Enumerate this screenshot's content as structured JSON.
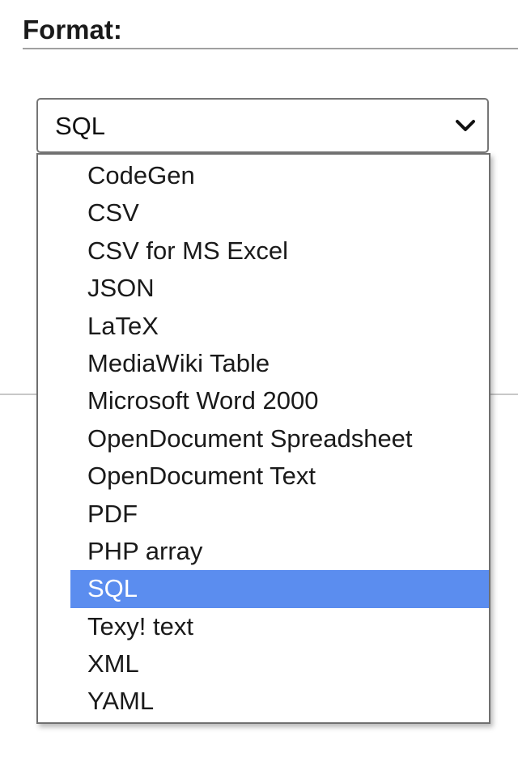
{
  "format_section": {
    "heading": "Format:"
  },
  "format_select": {
    "selected_value": "SQL",
    "chevron_icon": "chevron-down-icon",
    "options": [
      "CodeGen",
      "CSV",
      "CSV for MS Excel",
      "JSON",
      "LaTeX",
      "MediaWiki Table",
      "Microsoft Word 2000",
      "OpenDocument Spreadsheet",
      "OpenDocument Text",
      "PDF",
      "PHP array",
      "SQL",
      "Texy! text",
      "XML",
      "YAML"
    ],
    "highlighted_option": "SQL"
  },
  "colors": {
    "highlight": "#5b8def",
    "border": "#767676"
  }
}
